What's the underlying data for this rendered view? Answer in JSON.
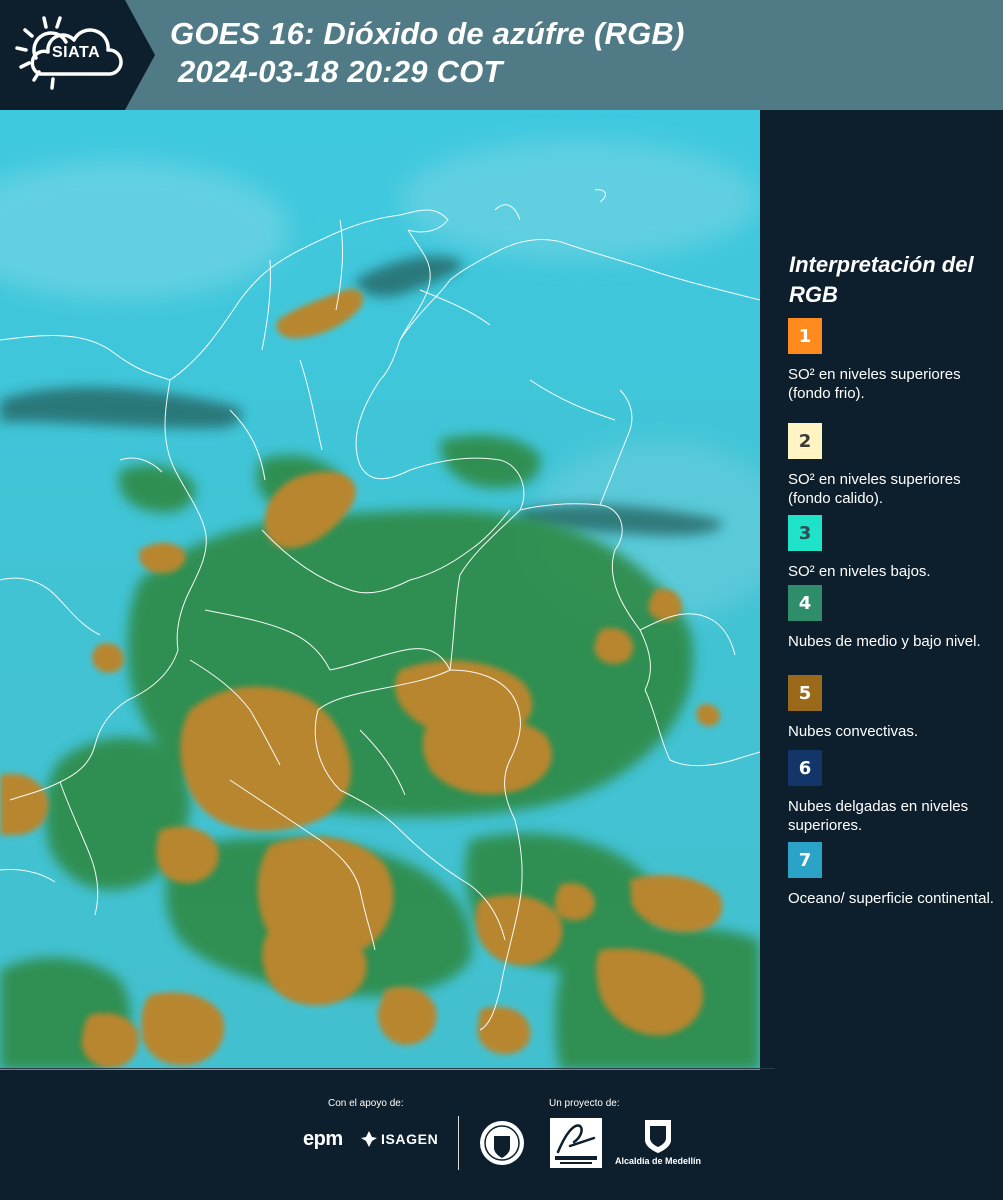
{
  "header": {
    "logo_text": "SIATA",
    "title": "GOES 16: Dióxido de azúfre (RGB)",
    "datetime": "2024-03-18 20:29 COT"
  },
  "legend": {
    "title": "Interpretación del RGB",
    "items": [
      {
        "number": "1",
        "label": "SO² en niveles superiores (fondo frio).",
        "color": "#ff8a1e",
        "text_color": "#ffffff"
      },
      {
        "number": "2",
        "label": "SO² en niveles superiores (fondo calido).",
        "color": "#fff4c2",
        "text_color": "#3a3a3a"
      },
      {
        "number": "3",
        "label": "SO² en niveles bajos.",
        "color": "#1ee3c8",
        "text_color": "#2d4d55"
      },
      {
        "number": "4",
        "label": "Nubes de medio y bajo nivel.",
        "color": "#2f8e6a",
        "text_color": "#ffffff"
      },
      {
        "number": "5",
        "label": "Nubes convectivas.",
        "color": "#9a6a1a",
        "text_color": "#ffffff"
      },
      {
        "number": "6",
        "label": "Nubes delgadas en niveles superiores.",
        "color": "#12366a",
        "text_color": "#ffffff"
      },
      {
        "number": "7",
        "label": "Oceano/ superficie continental.",
        "color": "#2aa3c7",
        "text_color": "#ffffff"
      }
    ]
  },
  "footer": {
    "support_label": "Con el apoyo de:",
    "project_label": "Un proyecto de:",
    "epm": "epm",
    "isagen": "ISAGEN",
    "alcaldia": "Alcaldía de Medellín"
  },
  "colors": {
    "header_band": "#507a86",
    "background": "#0d1f2d",
    "ocean": "#3cc6dc",
    "clouds_mid_low": "#2f8a45",
    "clouds_convective": "#b8862e",
    "borders": "#ffffff"
  }
}
